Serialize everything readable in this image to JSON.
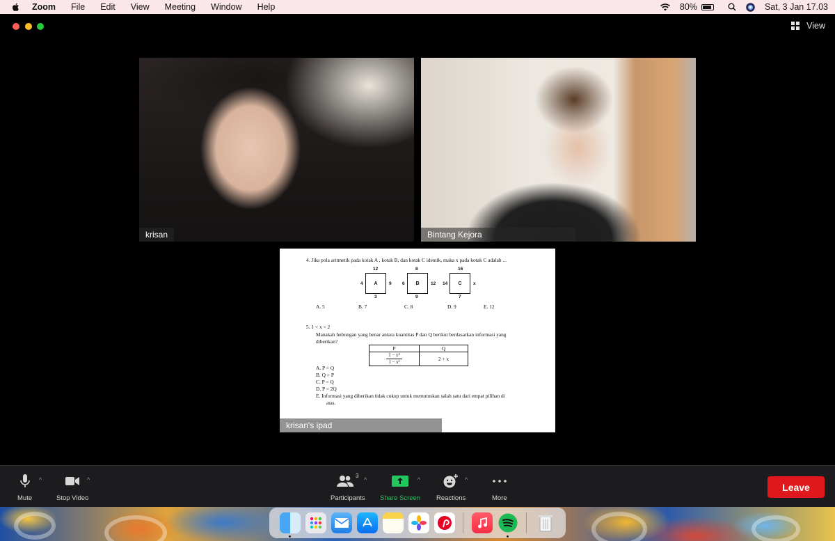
{
  "menubar": {
    "items": [
      "Zoom",
      "File",
      "Edit",
      "View",
      "Meeting",
      "Window",
      "Help"
    ],
    "battery": "80%",
    "datetime": "Sat, 3 Jan  17.03"
  },
  "window": {
    "view_label": "View",
    "participants": [
      {
        "name": "krisan"
      },
      {
        "name": "Bintang Kejora"
      }
    ],
    "share": {
      "name": "krisan's ipad",
      "q4": {
        "text": "4.    Jika pola aritmetik pada kotak A , kotak B, dan kotak C identik, maka x pada kotak C adalah ...",
        "boxes": [
          {
            "label": "A",
            "top": "12",
            "left": "4",
            "right": "9",
            "bottom": "3"
          },
          {
            "label": "B",
            "top": "8",
            "left": "6",
            "right": "12",
            "bottom": "9"
          },
          {
            "label": "C",
            "top": "16",
            "left": "14",
            "right": "x",
            "bottom": "7"
          }
        ],
        "options": [
          "A. 5",
          "B. 7",
          "C. 8",
          "D. 9",
          "E. 12"
        ]
      },
      "q5": {
        "cond": "5.    1  <  x  <  2",
        "text1": "Manakah hubungan yang benar antara kuantitas P dan Q berikut berdasarkan informasi yang",
        "text2": "diberikan?",
        "table_head": [
          "P",
          "Q"
        ],
        "p_num": "1 − x⁴",
        "p_den": "1 − x²",
        "q_val": "2 + x",
        "options": [
          "A.   P > Q",
          "B.   Q > P",
          "C.   P = Q",
          "D.   P = 2Q",
          "E.   Informasi yang diberikan tidak cukup untuk memutuskan salah satu dari empat pilihan di",
          "atas."
        ]
      }
    }
  },
  "toolbar": {
    "mute": "Mute",
    "stop_video": "Stop Video",
    "participants": "Participants",
    "participants_count": "3",
    "share_screen": "Share Screen",
    "reactions": "Reactions",
    "more": "More",
    "leave": "Leave"
  },
  "colors": {
    "leave": "#e0171c",
    "share_screen": "#22c55e",
    "menubar": "#fbe6ea"
  }
}
